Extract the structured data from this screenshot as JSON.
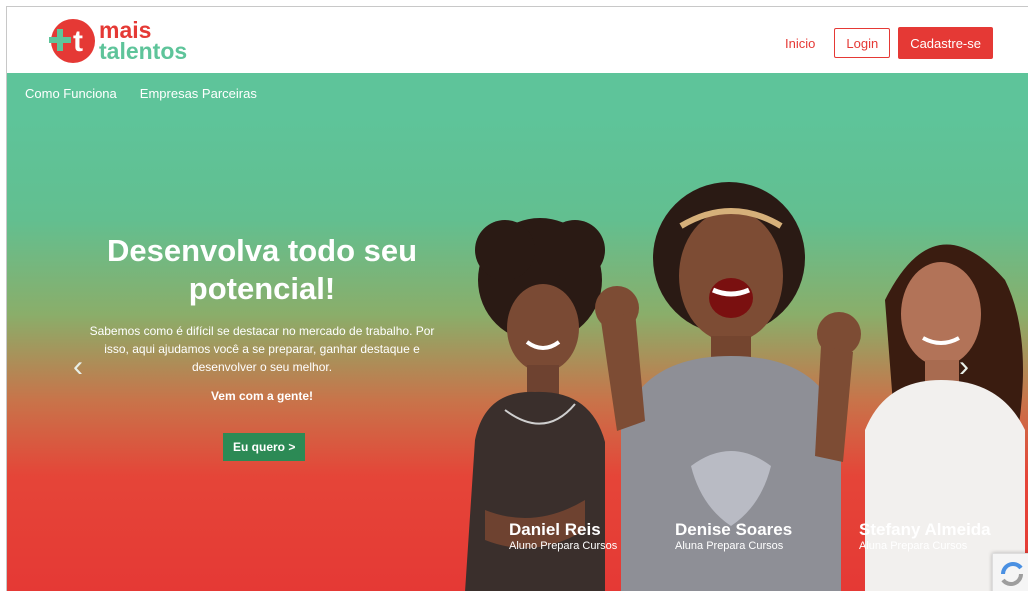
{
  "header": {
    "logo_line1": "mais",
    "logo_line2": "talentos",
    "logo_glyph": "+t",
    "inicio_label": "Inicio",
    "login_label": "Login",
    "cadastre_label": "Cadastre-se"
  },
  "subnav": {
    "items": [
      {
        "label": "Como Funciona"
      },
      {
        "label": "Empresas Parceiras"
      }
    ]
  },
  "hero": {
    "title": "Desenvolva todo seu potencial!",
    "description": "Sabemos como é difícil se destacar no mercado de trabalho. Por isso, aqui ajudamos você a se preparar, ganhar destaque e desenvolver o seu melhor.",
    "cta_text": "Vem com a gente!",
    "button_label": "Eu quero >",
    "prev_arrow": "‹",
    "next_arrow": "›"
  },
  "people": [
    {
      "name": "Daniel Reis",
      "role": "Aluno Prepara Cursos"
    },
    {
      "name": "Denise Soares",
      "role": "Aluna Prepara Cursos"
    },
    {
      "name": "Stefany Almeida",
      "role": "Aluna Prepara Cursos"
    }
  ],
  "colors": {
    "brand_red": "#e53935",
    "brand_green": "#5ec49a",
    "cta_green": "#2c8a55"
  }
}
